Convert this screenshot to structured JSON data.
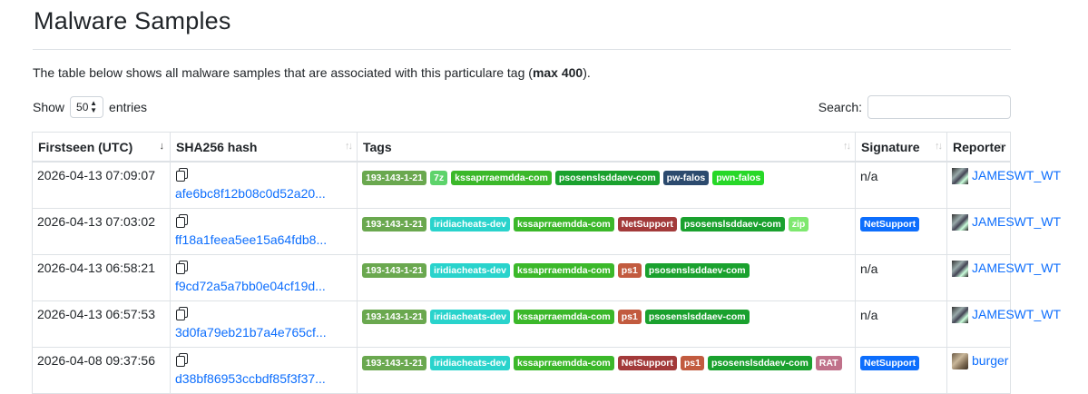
{
  "page": {
    "title": "Malware Samples",
    "description_before": "The table below shows all malware samples that are associated with this particulare tag (",
    "description_bold": "max 400",
    "description_after": ")."
  },
  "controls": {
    "show_label": "Show",
    "show_value": "50",
    "entries_label": "entries",
    "search_label": "Search:",
    "search_value": ""
  },
  "table": {
    "columns": [
      "Firstseen (UTC)",
      "SHA256 hash",
      "Tags",
      "Signature",
      "Reporter"
    ],
    "rows": [
      {
        "date": "2026-04-13 07:09:07",
        "hash": "afe6bc8f12b08c0d52a20...",
        "tags": [
          {
            "label": "193-143-1-21",
            "color": "#6aa84f"
          },
          {
            "label": "7z",
            "color": "#5dd36b"
          },
          {
            "label": "kssaprraemdda-com",
            "color": "#3bb82a"
          },
          {
            "label": "psosenslsddaev-com",
            "color": "#1aa12e"
          },
          {
            "label": "pw-falos",
            "color": "#2c4a6e"
          },
          {
            "label": "pwn-falos",
            "color": "#27d828"
          }
        ],
        "signature": "n/a",
        "signature_is_badge": false,
        "reporter": "JAMESWT_WT",
        "avatar": "jameswt-avatar"
      },
      {
        "date": "2026-04-13 07:03:02",
        "hash": "ff18a1feea5ee15a64fdb8...",
        "tags": [
          {
            "label": "193-143-1-21",
            "color": "#6aa84f"
          },
          {
            "label": "iridiacheats-dev",
            "color": "#29d3cc"
          },
          {
            "label": "kssaprraemdda-com",
            "color": "#3bb82a"
          },
          {
            "label": "NetSupport",
            "color": "#a33a3a"
          },
          {
            "label": "psosenslsddaev-com",
            "color": "#1aa12e"
          },
          {
            "label": "zip",
            "color": "#7ee86f"
          }
        ],
        "signature": "NetSupport",
        "signature_is_badge": true,
        "reporter": "JAMESWT_WT",
        "avatar": "jameswt-avatar"
      },
      {
        "date": "2026-04-13 06:58:21",
        "hash": "f9cd72a5a7bb0e04cf19d...",
        "tags": [
          {
            "label": "193-143-1-21",
            "color": "#6aa84f"
          },
          {
            "label": "iridiacheats-dev",
            "color": "#29d3cc"
          },
          {
            "label": "kssaprraemdda-com",
            "color": "#3bb82a"
          },
          {
            "label": "ps1",
            "color": "#c25b3f"
          },
          {
            "label": "psosenslsddaev-com",
            "color": "#1aa12e"
          }
        ],
        "signature": "n/a",
        "signature_is_badge": false,
        "reporter": "JAMESWT_WT",
        "avatar": "jameswt-avatar"
      },
      {
        "date": "2026-04-13 06:57:53",
        "hash": "3d0fa79eb21b7a4e765cf...",
        "tags": [
          {
            "label": "193-143-1-21",
            "color": "#6aa84f"
          },
          {
            "label": "iridiacheats-dev",
            "color": "#29d3cc"
          },
          {
            "label": "kssaprraemdda-com",
            "color": "#3bb82a"
          },
          {
            "label": "ps1",
            "color": "#c25b3f"
          },
          {
            "label": "psosenslsddaev-com",
            "color": "#1aa12e"
          }
        ],
        "signature": "n/a",
        "signature_is_badge": false,
        "reporter": "JAMESWT_WT",
        "avatar": "jameswt-avatar"
      },
      {
        "date": "2026-04-08 09:37:56",
        "hash": "d38bf86953ccbdf85f3f37...",
        "tags": [
          {
            "label": "193-143-1-21",
            "color": "#6aa84f"
          },
          {
            "label": "iridiacheats-dev",
            "color": "#29d3cc"
          },
          {
            "label": "kssaprraemdda-com",
            "color": "#3bb82a"
          },
          {
            "label": "NetSupport",
            "color": "#a33a3a"
          },
          {
            "label": "ps1",
            "color": "#c25b3f"
          },
          {
            "label": "psosenslsddaev-com",
            "color": "#1aa12e"
          },
          {
            "label": "RAT",
            "color": "#c0718a"
          }
        ],
        "signature": "NetSupport",
        "signature_is_badge": true,
        "reporter": "burger",
        "avatar": "burger-avatar"
      }
    ]
  }
}
